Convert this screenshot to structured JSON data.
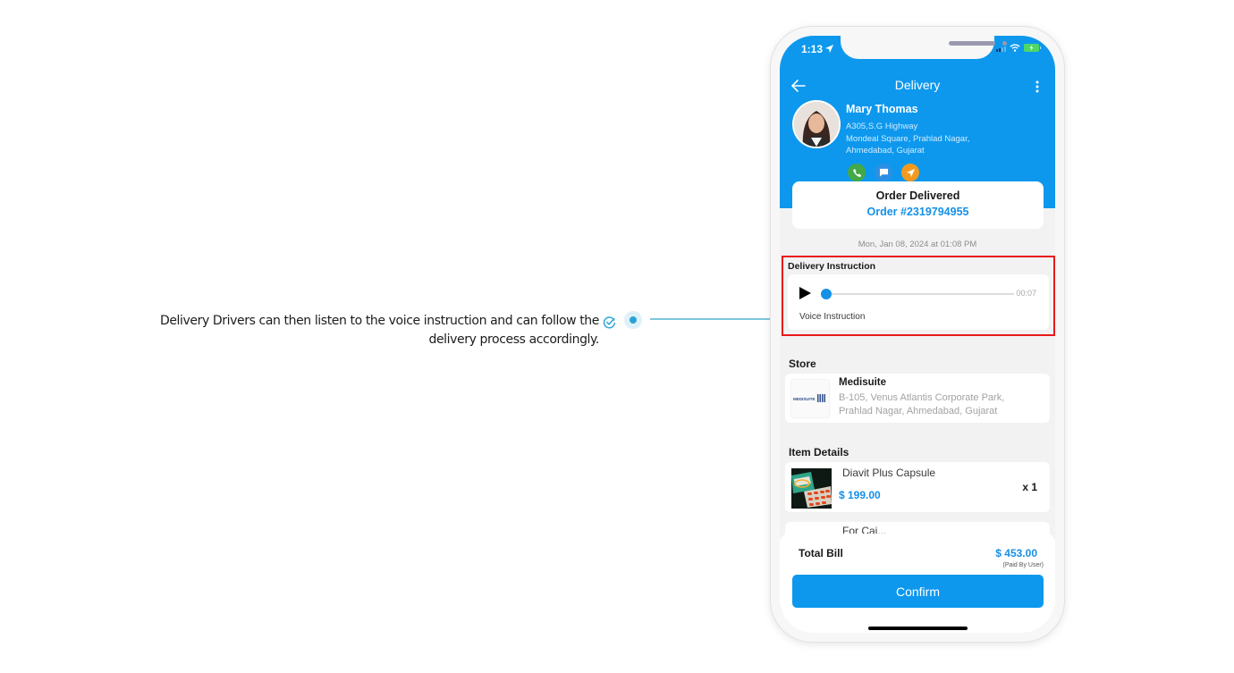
{
  "callout": {
    "text": "Delivery Drivers can then listen to the voice instruction and can follow the delivery process accordingly.",
    "icon": "check-circle-icon"
  },
  "status_bar": {
    "time": "1:13",
    "icons": [
      "location-arrow-icon",
      "signal-icon",
      "wifi-icon",
      "battery-charging-icon"
    ]
  },
  "nav": {
    "title": "Delivery",
    "back_icon": "arrow-left-icon",
    "more_icon": "more-vertical-icon"
  },
  "customer": {
    "name": "Mary Thomas",
    "address_line1": "A305,S.G Highway",
    "address_line2": "Mondeal Square, Prahlad Nagar,",
    "address_line3": "Ahmedabad, Gujarat",
    "actions": [
      {
        "name": "call",
        "icon": "phone-icon",
        "color": "#43a846"
      },
      {
        "name": "message",
        "icon": "chat-icon",
        "color": "#2d8fe2"
      },
      {
        "name": "navigate",
        "icon": "navigation-icon",
        "color": "#f39a1e"
      }
    ]
  },
  "order": {
    "status": "Order Delivered",
    "number": "Order #2319794955",
    "date": "Mon, Jan 08, 2024 at 01:08 PM"
  },
  "delivery_instruction": {
    "title": "Delivery Instruction",
    "duration": "00:07",
    "progress": 0,
    "label": "Voice Instruction"
  },
  "store": {
    "section_title": "Store",
    "name": "Medisuite",
    "address_line1": "B-105, Venus Atlantis Corporate Park,",
    "address_line2": "Prahlad Nagar, Ahmedabad, Gujarat",
    "logo_text": "MEDISUITE"
  },
  "items": {
    "section_title": "Item Details",
    "list": [
      {
        "name": "Diavit Plus Capsule",
        "price": "$ 199.00",
        "qty": "x 1"
      },
      {
        "name": "For Cai...",
        "price": "",
        "qty": ""
      }
    ]
  },
  "bill": {
    "label": "Total Bill",
    "value": "$ 453.00",
    "note": "(Paid By User)",
    "confirm_label": "Confirm"
  },
  "colors": {
    "primary": "#0d98ee",
    "highlight": "#e81919",
    "accent_link": "#1590e6"
  }
}
